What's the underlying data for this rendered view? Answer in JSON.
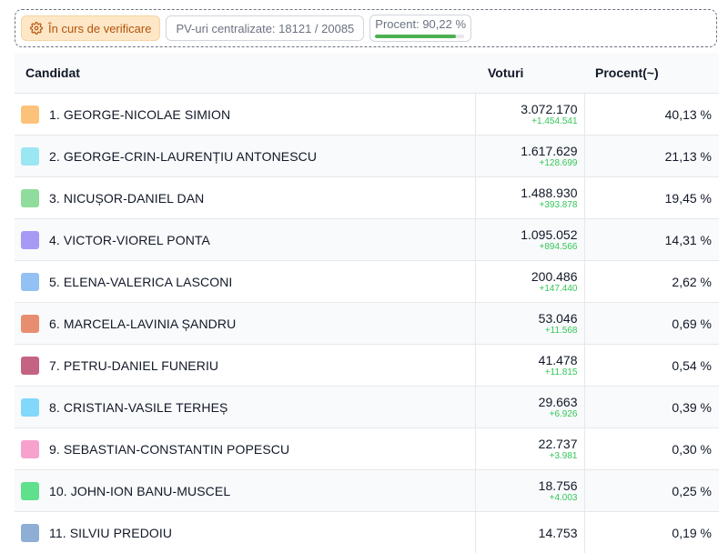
{
  "status": {
    "state_label": "În curs de verificare",
    "pv_label": "PV-uri centralizate: 18121 / 20085",
    "percent_label": "Procent: 90,22 %",
    "progress": 0.9022,
    "colors": {
      "badge_bg": "#fde7c7",
      "badge_text": "#b45309",
      "progress": "#4caf50"
    },
    "icon": "gear-icon"
  },
  "table": {
    "headers": {
      "candidate": "Candidat",
      "votes": "Voturi",
      "percent": "Procent(~)"
    },
    "rows": [
      {
        "name": "1. GEORGE-NICOLAE SIMION",
        "votes": "3.072.170",
        "delta": "+1.454.541",
        "percent": "40,13 %",
        "color": "#fdc27a"
      },
      {
        "name": "2. GEORGE-CRIN-LAURENȚIU ANTONESCU",
        "votes": "1.617.629",
        "delta": "+128.699",
        "percent": "21,13 %",
        "color": "#9be6f3"
      },
      {
        "name": "3. NICUȘOR-DANIEL DAN",
        "votes": "1.488.930",
        "delta": "+393.878",
        "percent": "19,45 %",
        "color": "#8fdc9d"
      },
      {
        "name": "4. VICTOR-VIOREL PONTA",
        "votes": "1.095.052",
        "delta": "+894.566",
        "percent": "14,31 %",
        "color": "#a79af5"
      },
      {
        "name": "5. ELENA-VALERICA LASCONI",
        "votes": "200.486",
        "delta": "+147.440",
        "percent": "2,62 %",
        "color": "#93c1f3"
      },
      {
        "name": "6. MARCELA-LAVINIA ȘANDRU",
        "votes": "53.046",
        "delta": "+11.568",
        "percent": "0,69 %",
        "color": "#e88e70"
      },
      {
        "name": "7. PETRU-DANIEL FUNERIU",
        "votes": "41.478",
        "delta": "+11.815",
        "percent": "0,54 %",
        "color": "#c46382"
      },
      {
        "name": "8. CRISTIAN-VASILE TERHEȘ",
        "votes": "29.663",
        "delta": "+6.926",
        "percent": "0,39 %",
        "color": "#82d8fa"
      },
      {
        "name": "9. SEBASTIAN-CONSTANTIN POPESCU",
        "votes": "22.737",
        "delta": "+3.981",
        "percent": "0,30 %",
        "color": "#f6a2cd"
      },
      {
        "name": "10. JOHN-ION BANU-MUSCEL",
        "votes": "18.756",
        "delta": "+4.003",
        "percent": "0,25 %",
        "color": "#5ee08c"
      },
      {
        "name": "11. SILVIU PREDOIU",
        "votes": "14.753",
        "delta": "",
        "percent": "0,19 %",
        "color": "#8eaed6"
      }
    ]
  }
}
